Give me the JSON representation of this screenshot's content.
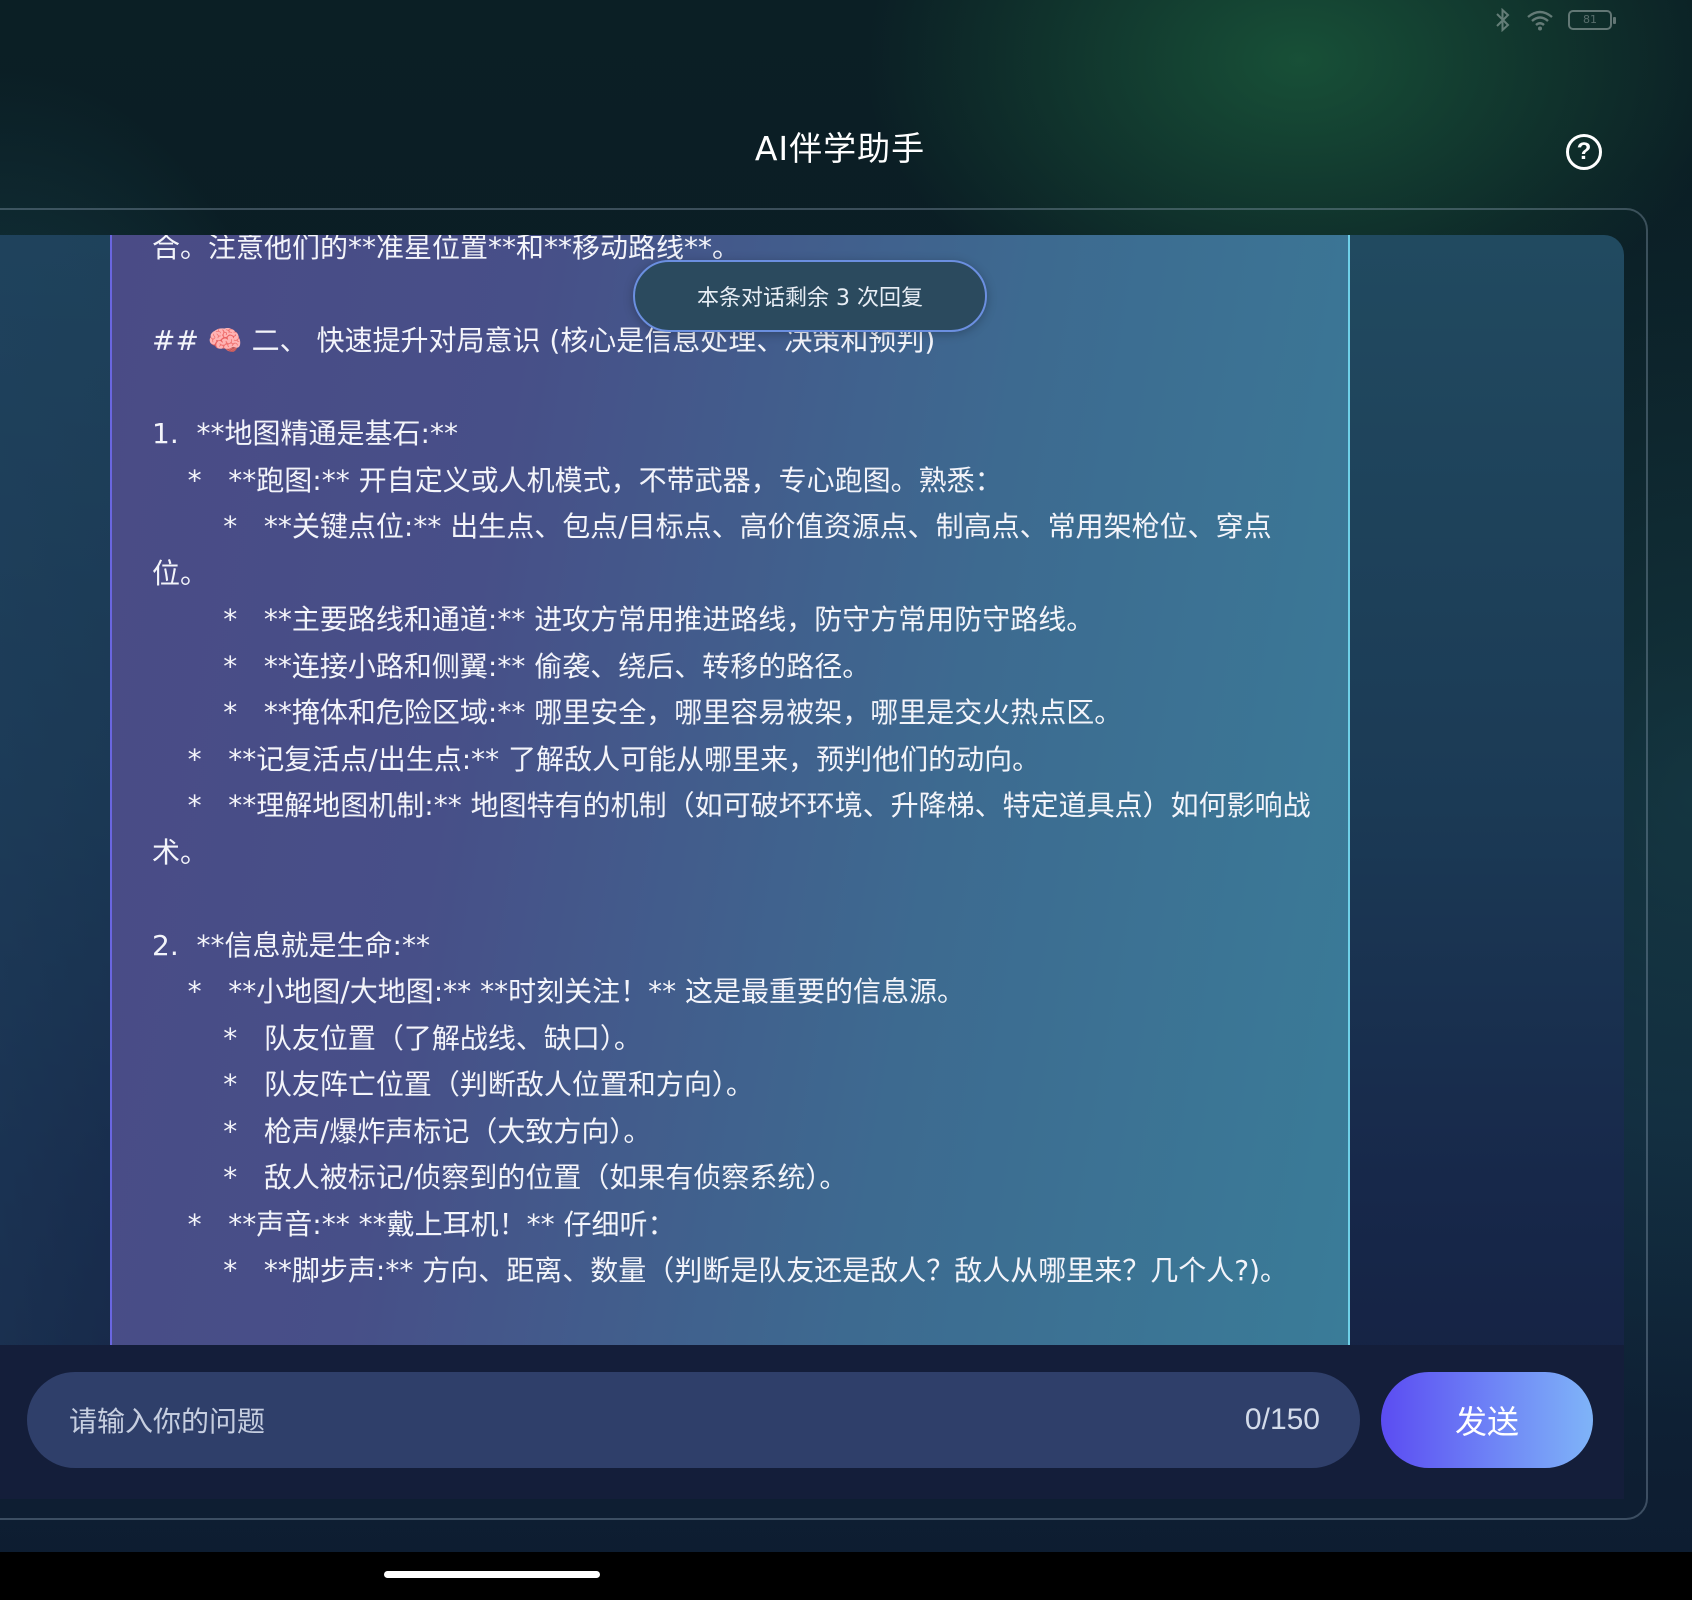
{
  "status_bar": {
    "bluetooth_icon": "bluetooth-icon",
    "wifi_icon": "wifi-icon",
    "battery_level": "81"
  },
  "header": {
    "title": "AI伴学助手",
    "help_icon": "question-circle-icon",
    "help_label": "?"
  },
  "notice": {
    "remaining_text": "本条对话剩余 3 次回复"
  },
  "message": {
    "lines": [
      "合。注意他们的**准星位置**和**移动路线**。",
      "",
      "## 🧠 二、 快速提升对局意识 (核心是信息处理、决策和预判)",
      "",
      "1.  **地图精通是基石:**",
      "    *   **跑图:** 开自定义或人机模式，不带武器，专心跑图。熟悉：",
      "        *   **关键点位:** 出生点、包点/目标点、高价值资源点、制高点、常用架枪位、穿点位。",
      "        *   **主要路线和通道:** 进攻方常用推进路线，防守方常用防守路线。",
      "        *   **连接小路和侧翼:** 偷袭、绕后、转移的路径。",
      "        *   **掩体和危险区域:** 哪里安全，哪里容易被架，哪里是交火热点区。",
      "    *   **记复活点/出生点:** 了解敌人可能从哪里来，预判他们的动向。",
      "    *   **理解地图机制:** 地图特有的机制（如可破坏环境、升降梯、特定道具点）如何影响战术。",
      "",
      "2.  **信息就是生命:**",
      "    *   **小地图/大地图:** **时刻关注！** 这是最重要的信息源。",
      "        *   队友位置（了解战线、缺口）。",
      "        *   队友阵亡位置（判断敌人位置和方向）。",
      "        *   枪声/爆炸声标记（大致方向）。",
      "        *   敌人被标记/侦察到的位置（如果有侦察系统）。",
      "    *   **声音:** **戴上耳机！** 仔细听：",
      "        *   **脚步声:** 方向、距离、数量（判断是队友还是敌人？敌人从哪里来？几个人?)。"
    ]
  },
  "input": {
    "placeholder": "请输入你的问题",
    "value": "",
    "char_count": "0/150"
  },
  "send_button": {
    "label": "发送"
  }
}
